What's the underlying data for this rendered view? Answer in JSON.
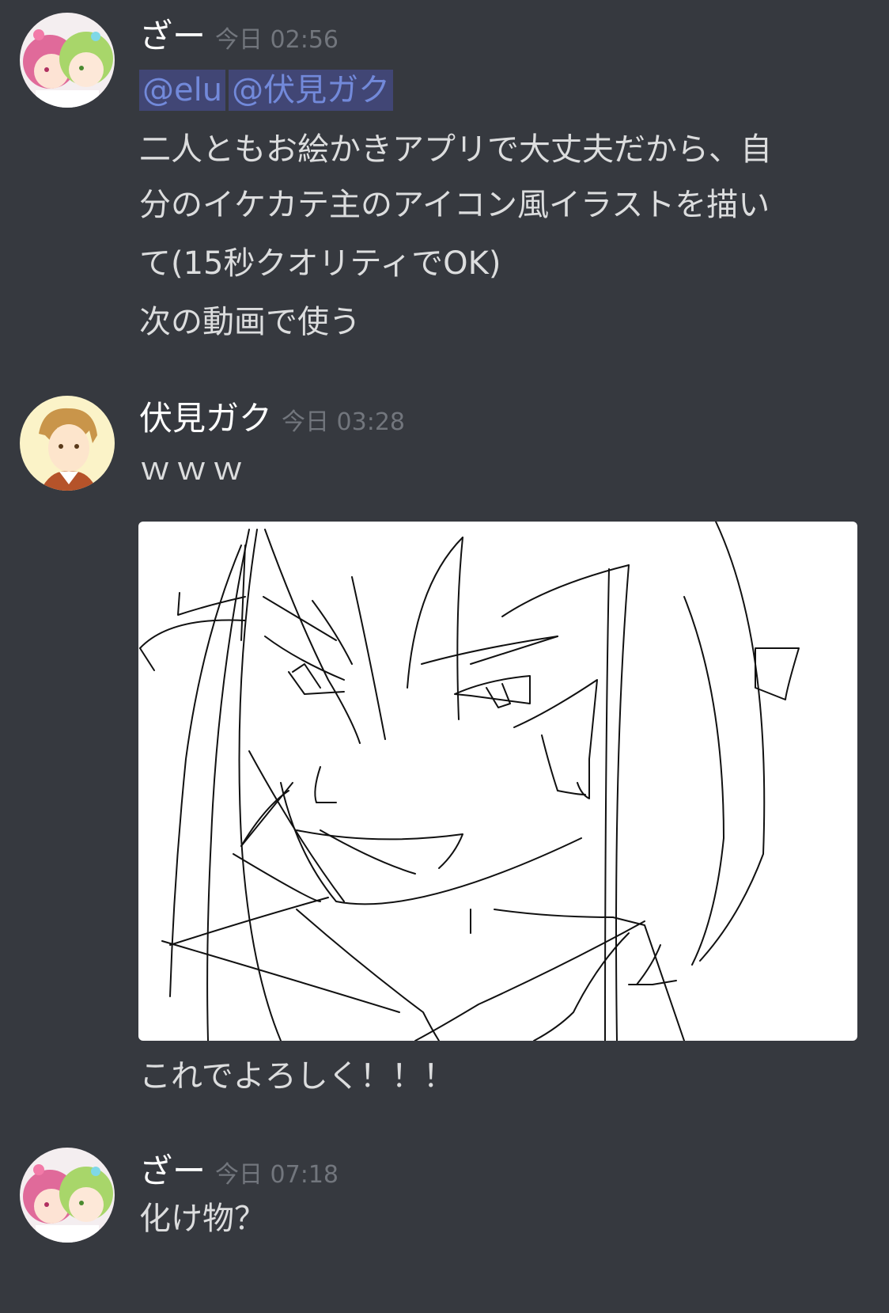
{
  "messages": [
    {
      "username": "ざー",
      "timestamp": "今日 02:56",
      "mentions": [
        "@elu",
        "@伏見ガク"
      ],
      "lines": [
        "二人ともお絵かきアプリで大丈夫だから、自",
        "分のイケカテ主のアイコン風イラストを描い",
        "て(15秒クオリティでOK)",
        "次の動画で使う"
      ]
    },
    {
      "username": "伏見ガク",
      "timestamp": "今日 03:28",
      "lines": [
        "ｗｗｗ"
      ],
      "followup": "これでよろしく！！！"
    },
    {
      "username": "ざー",
      "timestamp": "今日 07:18",
      "lines": [
        "化け物？"
      ]
    }
  ],
  "colors": {
    "background": "#36393f",
    "username": "#ffffff",
    "timestamp": "#72767d",
    "text": "#dcddde",
    "mention_bg": "#414675",
    "mention_text": "#7289da"
  }
}
